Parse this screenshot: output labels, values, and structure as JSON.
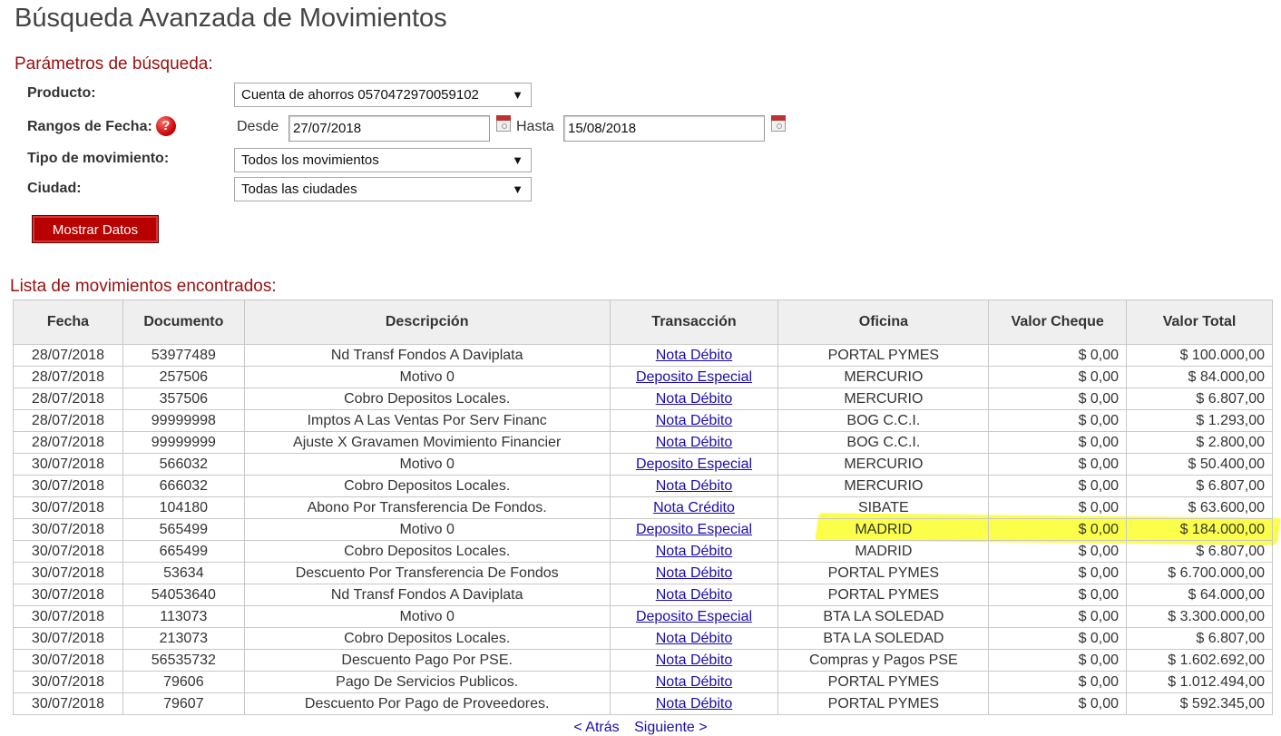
{
  "page": {
    "title": "Búsqueda Avanzada de Movimientos"
  },
  "search": {
    "section_title": "Parámetros de búsqueda:",
    "product_label": "Producto:",
    "product_value": "Cuenta de ahorros 0570472970059102",
    "date_label": "Rangos de Fecha:",
    "help_icon_glyph": "?",
    "from_label": "Desde",
    "from_value": "27/07/2018",
    "to_label": "Hasta",
    "to_value": "15/08/2018",
    "type_label": "Tipo de movimiento:",
    "type_value": "Todos los movimientos",
    "city_label": "Ciudad:",
    "city_value": "Todas las ciudades",
    "submit_label": "Mostrar Datos",
    "dropdown_arrow": "▼"
  },
  "results": {
    "section_title": "Lista de movimientos encontrados:",
    "headers": [
      "Fecha",
      "Documento",
      "Descripción",
      "Transacción",
      "Oficina",
      "Valor Cheque",
      "Valor Total"
    ],
    "rows": [
      [
        "28/07/2018",
        "53977489",
        "Nd Transf Fondos A Daviplata",
        "Nota Débito",
        "PORTAL PYMES",
        "$ 0,00",
        "$ 100.000,00"
      ],
      [
        "28/07/2018",
        "257506",
        "Motivo 0",
        "Deposito Especial",
        "MERCURIO",
        "$ 0,00",
        "$ 84.000,00"
      ],
      [
        "28/07/2018",
        "357506",
        "Cobro Depositos Locales.",
        "Nota Débito",
        "MERCURIO",
        "$ 0,00",
        "$ 6.807,00"
      ],
      [
        "28/07/2018",
        "99999998",
        "Imptos A Las Ventas Por Serv Financ",
        "Nota Débito",
        "BOG C.C.I.",
        "$ 0,00",
        "$ 1.293,00"
      ],
      [
        "28/07/2018",
        "99999999",
        "Ajuste X Gravamen Movimiento Financier",
        "Nota Débito",
        "BOG C.C.I.",
        "$ 0,00",
        "$ 2.800,00"
      ],
      [
        "30/07/2018",
        "566032",
        "Motivo 0",
        "Deposito Especial",
        "MERCURIO",
        "$ 0,00",
        "$ 50.400,00"
      ],
      [
        "30/07/2018",
        "666032",
        "Cobro Depositos Locales.",
        "Nota Débito",
        "MERCURIO",
        "$ 0,00",
        "$ 6.807,00"
      ],
      [
        "30/07/2018",
        "104180",
        "Abono Por Transferencia De Fondos.",
        "Nota Crédito",
        "SIBATE",
        "$ 0,00",
        "$ 63.600,00"
      ],
      [
        "30/07/2018",
        "565499",
        "Motivo 0",
        "Deposito Especial",
        "MADRID",
        "$ 0,00",
        "$ 184.000,00"
      ],
      [
        "30/07/2018",
        "665499",
        "Cobro Depositos Locales.",
        "Nota Débito",
        "MADRID",
        "$ 0,00",
        "$ 6.807,00"
      ],
      [
        "30/07/2018",
        "53634",
        "Descuento Por Transferencia De Fondos",
        "Nota Débito",
        "PORTAL PYMES",
        "$ 0,00",
        "$ 6.700.000,00"
      ],
      [
        "30/07/2018",
        "54053640",
        "Nd Transf Fondos A Daviplata",
        "Nota Débito",
        "PORTAL PYMES",
        "$ 0,00",
        "$ 64.000,00"
      ],
      [
        "30/07/2018",
        "113073",
        "Motivo 0",
        "Deposito Especial",
        "BTA LA SOLEDAD",
        "$ 0,00",
        "$ 3.300.000,00"
      ],
      [
        "30/07/2018",
        "213073",
        "Cobro Depositos Locales.",
        "Nota Débito",
        "BTA LA SOLEDAD",
        "$ 0,00",
        "$ 6.807,00"
      ],
      [
        "30/07/2018",
        "56535732",
        "Descuento Pago Por PSE.",
        "Nota Débito",
        "Compras y Pagos PSE",
        "$ 0,00",
        "$ 1.602.692,00"
      ],
      [
        "30/07/2018",
        "79606",
        "Pago De Servicios Publicos.",
        "Nota Débito",
        "PORTAL PYMES",
        "$ 0,00",
        "$ 1.012.494,00"
      ],
      [
        "30/07/2018",
        "79607",
        "Descuento Por Pago de Proveedores.",
        "Nota Débito",
        "PORTAL PYMES",
        "$ 0,00",
        "$ 592.345,00"
      ]
    ],
    "highlighted_row_index": 8,
    "highlight_color": "#fbff2a"
  },
  "pagination": {
    "prev_label": "< Atrás",
    "next_label": "Siguiente >"
  },
  "colors": {
    "accent": "#9a0f0f",
    "button_bg": "#b90000",
    "link": "#1a0dab"
  }
}
